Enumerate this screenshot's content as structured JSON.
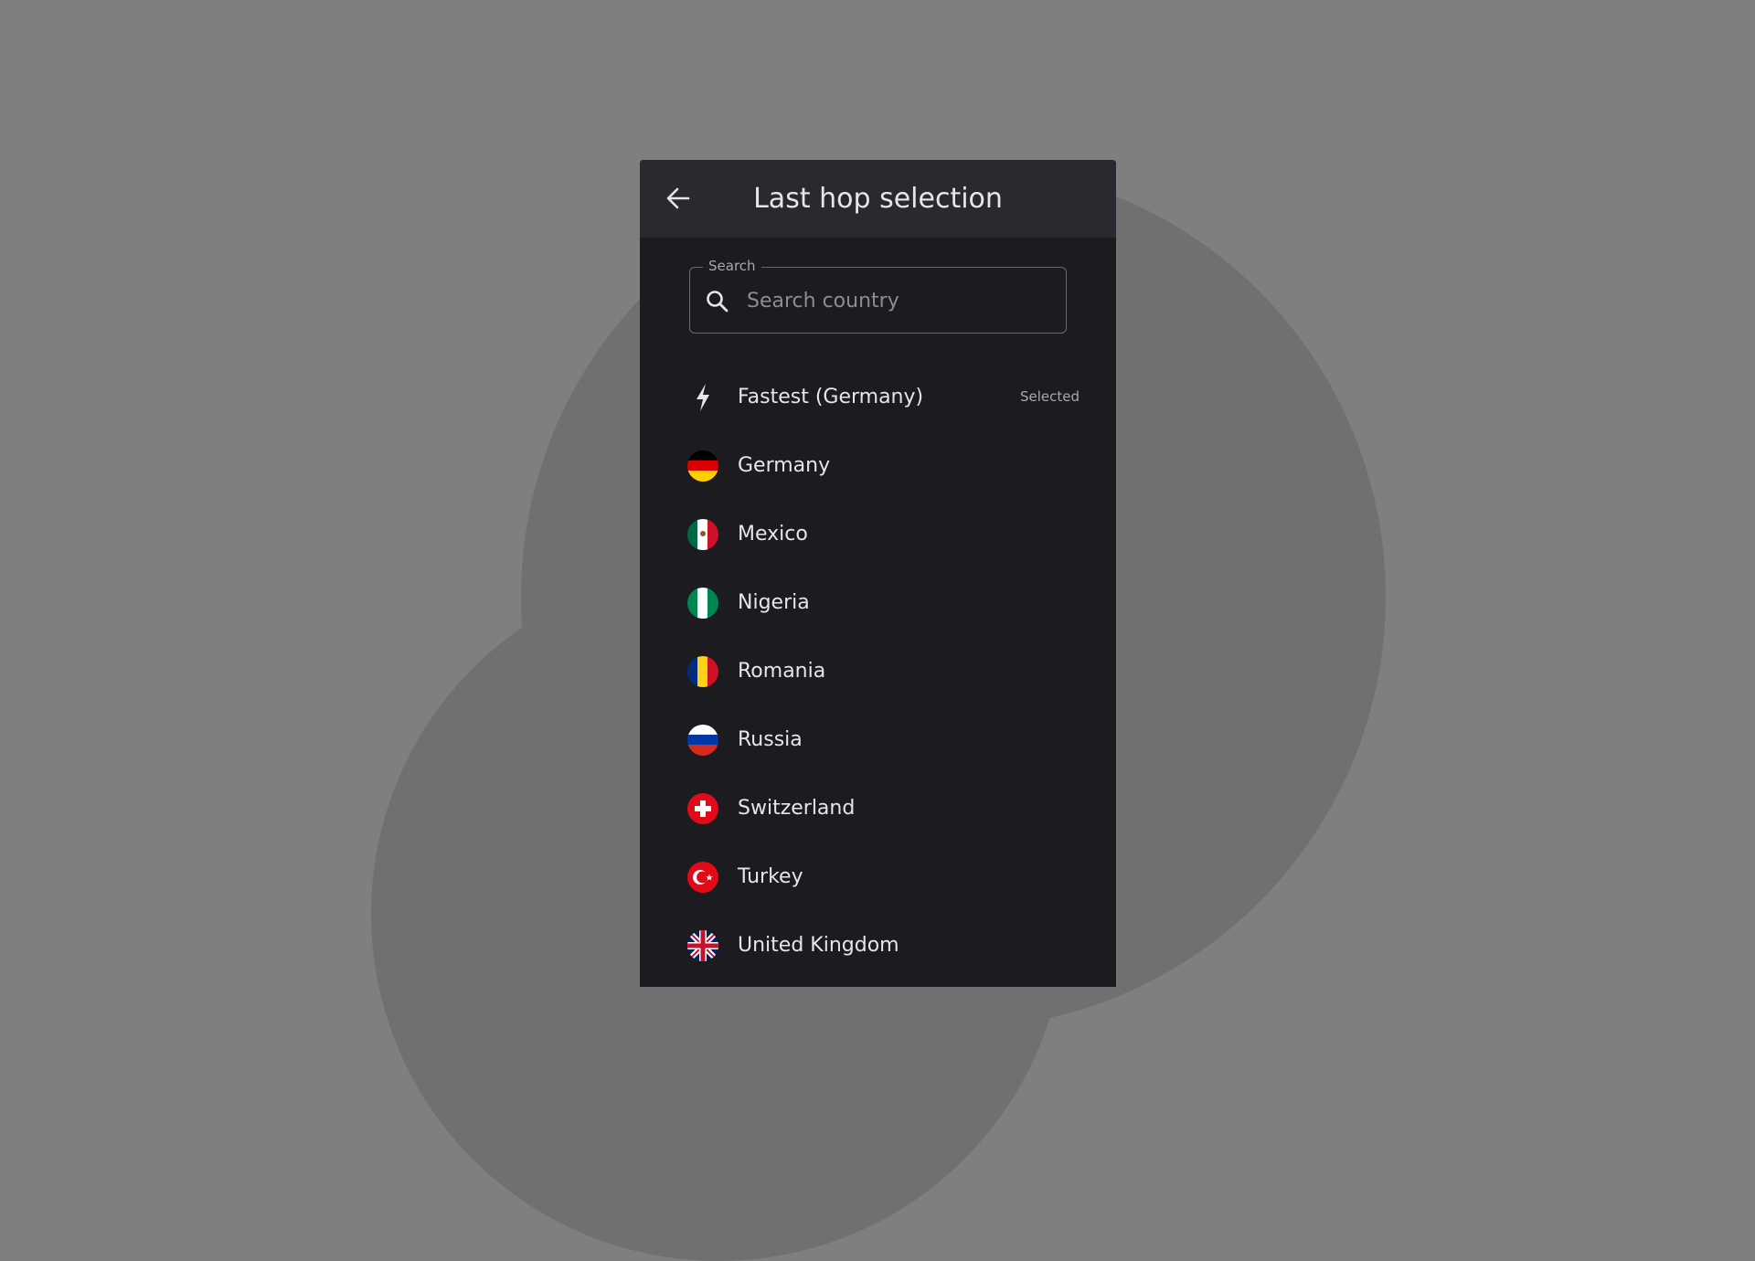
{
  "header": {
    "title": "Last hop selection",
    "back_icon": "arrow-left-icon"
  },
  "search": {
    "legend": "Search",
    "placeholder": "Search country",
    "value": "",
    "icon": "search-icon"
  },
  "list": {
    "fastest": {
      "label": "Fastest (Germany)",
      "status": "Selected",
      "icon": "bolt-icon"
    },
    "countries": [
      {
        "label": "Germany",
        "icon": "flag-germany-icon"
      },
      {
        "label": "Mexico",
        "icon": "flag-mexico-icon"
      },
      {
        "label": "Nigeria",
        "icon": "flag-nigeria-icon"
      },
      {
        "label": "Romania",
        "icon": "flag-romania-icon"
      },
      {
        "label": "Russia",
        "icon": "flag-russia-icon"
      },
      {
        "label": "Switzerland",
        "icon": "flag-switzerland-icon"
      },
      {
        "label": "Turkey",
        "icon": "flag-turkey-icon"
      },
      {
        "label": "United Kingdom",
        "icon": "flag-uk-icon"
      }
    ]
  },
  "colors": {
    "background": "#7f7f7f",
    "panel": "#1c1b20",
    "header": "#2a2930",
    "text": "#e6e6ea",
    "muted": "#a9a8ae"
  }
}
